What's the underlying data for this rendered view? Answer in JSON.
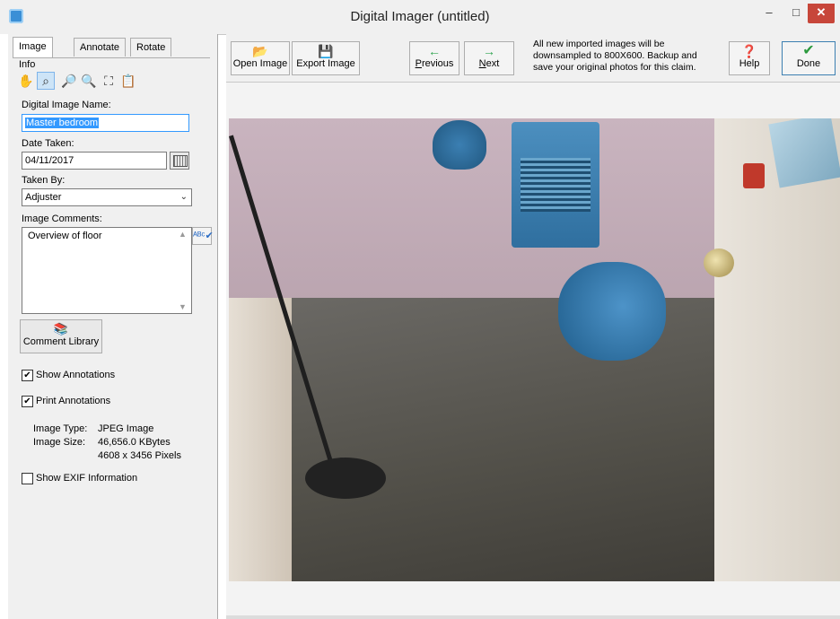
{
  "window": {
    "title": "Digital Imager (untitled)",
    "min_glyph": "–",
    "max_glyph": "□",
    "close_glyph": "✕"
  },
  "tabs": [
    {
      "label": "Image Info",
      "active": true
    },
    {
      "label": "Annotate",
      "active": false
    },
    {
      "label": "Rotate",
      "active": false
    }
  ],
  "tools": [
    {
      "name": "pan-hand-icon",
      "glyph": "✋"
    },
    {
      "name": "zoom-select-icon",
      "glyph": "⌕"
    },
    {
      "name": "zoom-in-icon",
      "glyph": "🔎"
    },
    {
      "name": "zoom-out-icon",
      "glyph": "🔍"
    },
    {
      "name": "fit-to-window-icon",
      "glyph": "⛶"
    },
    {
      "name": "clipboard-icon",
      "glyph": "📋"
    }
  ],
  "fields": {
    "name_label": "Digital Image Name:",
    "name_value": "Master bedroom",
    "date_label": "Date Taken:",
    "date_value": "04/11/2017",
    "taken_by_label": "Taken By:",
    "taken_by_value": "Adjuster",
    "comments_label": "Image Comments:",
    "comments_value": "Overview of floor"
  },
  "buttons": {
    "comment_library": "Comment Library",
    "open_image": "Open Image",
    "export_image": "Export Image",
    "previous_P": "P",
    "previous_rest": "revious",
    "next_N": "N",
    "next_rest": "ext",
    "help": "Help",
    "done": "Done"
  },
  "icons": {
    "open": "📂",
    "export": "💾",
    "prev": "←",
    "next": "→",
    "help": "❓",
    "done": "✔",
    "library": "📚",
    "spell": "ᴬᴮᶜ✔",
    "calendar": "calendar-icon",
    "dropdown": "⌄",
    "up": "▲",
    "down": "▼",
    "check": "✔"
  },
  "colors": {
    "prev_next_arrow": "#2fa44f",
    "done_check": "#2c9a3e",
    "selection": "#3399ff"
  },
  "checkboxes": {
    "show_annotations": {
      "label": "Show Annotations",
      "checked": true
    },
    "print_annotations": {
      "label": "Print Annotations",
      "checked": true
    },
    "show_exif": {
      "label": "Show EXIF Information",
      "checked": false
    }
  },
  "image_info": {
    "type_label": "Image Type:",
    "type_value": "JPEG Image",
    "size_label": "Image Size:",
    "size_value": "46,656.0 KBytes",
    "pixels_value": "4608 x 3456 Pixels"
  },
  "notice": "All new imported images will be downsampled to 800X600. Backup and save your original photos for this claim."
}
